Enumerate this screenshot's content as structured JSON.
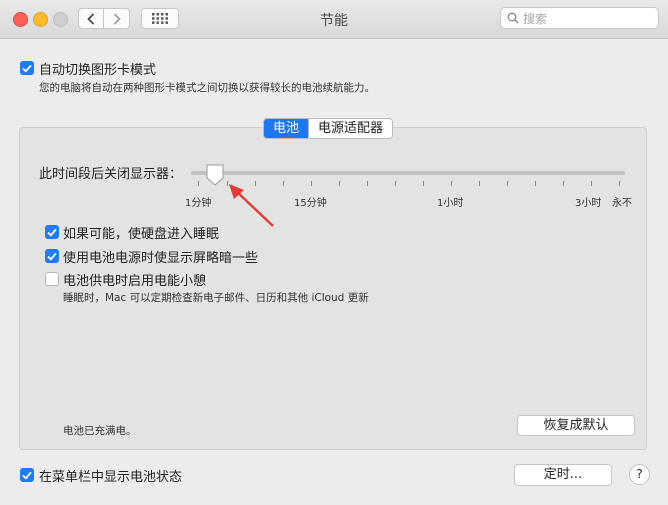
{
  "window": {
    "title": "节能"
  },
  "search": {
    "placeholder": "搜索"
  },
  "top_option": {
    "label": "自动切换图形卡模式",
    "checked": true,
    "description": "您的电脑将自动在两种图形卡模式之间切换以获得较长的电池续航能力。"
  },
  "tabs": [
    {
      "label": "电池",
      "active": true
    },
    {
      "label": "电源适配器",
      "active": false
    }
  ],
  "slider": {
    "label": "此时间段后关闭显示器：",
    "tick_labels": [
      "1分钟",
      "15分钟",
      "1小时",
      "3小时",
      "永不"
    ],
    "value": "2分钟"
  },
  "options": [
    {
      "label": "如果可能，使硬盘进入睡眠",
      "checked": true
    },
    {
      "label": "使用电池电源时使显示屏略暗一些",
      "checked": true
    },
    {
      "label": "电池供电时启用电能小憩",
      "checked": false,
      "description": "睡眠时，Mac 可以定期检查新电子邮件、日历和其他 iCloud 更新"
    }
  ],
  "battery_status": "电池已充满电。",
  "restore_button": "恢复成默认",
  "menubar_option": {
    "label": "在菜单栏中显示电池状态",
    "checked": true
  },
  "schedule_button": "定时...",
  "help_button": "?",
  "colors": {
    "accent": "#1f7cf6",
    "arrow": "#e53935"
  }
}
